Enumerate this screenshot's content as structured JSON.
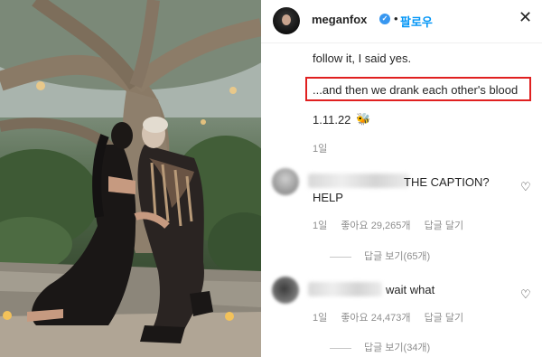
{
  "post": {
    "username": "meganfox",
    "verified_glyph": "✓",
    "separator": "•",
    "follow_label": "팔로우",
    "close_glyph": "✕",
    "caption_line1": "follow it, I said yes.",
    "caption_line2": "...and then we drank each other's blood",
    "caption_line3": "1.11.22",
    "caption_emoji": "🐝",
    "time_ago": "1일",
    "highlight_color": "#e02020"
  },
  "comments": [
    {
      "text_line1": "THE CAPTION?",
      "text_line2": "HELP",
      "time": "1일",
      "likes": "좋아요 29,265개",
      "reply_label": "답글 달기",
      "view_replies": "답글 보기(65개)",
      "like_icon": "heart-outline-icon"
    },
    {
      "text_line1": "wait what",
      "time": "1일",
      "likes": "좋아요 24,473개",
      "reply_label": "답글 달기",
      "view_replies": "답글 보기(34개)",
      "like_icon": "heart-outline-icon"
    }
  ],
  "colors": {
    "link_blue": "#0095f6",
    "verified_blue": "#3897f0",
    "meta_gray": "#8e8e8e"
  }
}
